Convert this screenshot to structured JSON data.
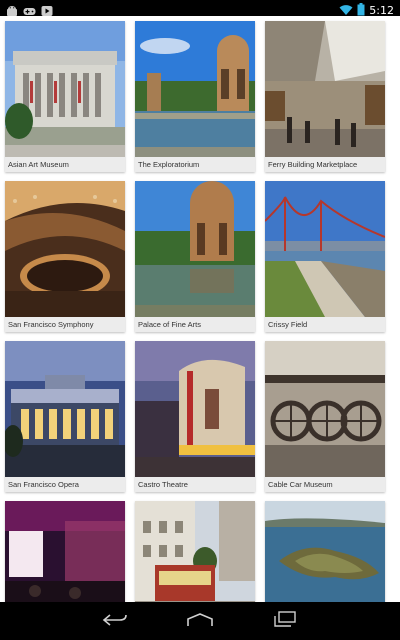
{
  "status_bar": {
    "time": "5:12",
    "left_icons": [
      "android-icon",
      "gamepad-icon",
      "play-icon"
    ],
    "right_icons": [
      "wifi-icon",
      "battery-icon"
    ]
  },
  "places": [
    {
      "label": "Asian Art Museum",
      "image": "asian-art-museum-photo"
    },
    {
      "label": "The Exploratorium",
      "image": "exploratorium-photo"
    },
    {
      "label": "Ferry Building Marketplace",
      "image": "ferry-building-photo"
    },
    {
      "label": "San Francisco Symphony",
      "image": "symphony-photo"
    },
    {
      "label": "Palace of Fine Arts",
      "image": "palace-of-fine-arts-photo"
    },
    {
      "label": "Crissy Field",
      "image": "crissy-field-photo"
    },
    {
      "label": "San Francisco Opera",
      "image": "opera-photo"
    },
    {
      "label": "Castro Theatre",
      "image": "castro-theatre-photo"
    },
    {
      "label": "Cable Car Museum",
      "image": "cable-car-museum-photo"
    },
    {
      "label": "",
      "image": "concert-stage-photo"
    },
    {
      "label": "",
      "image": "cable-car-street-photo"
    },
    {
      "label": "",
      "image": "island-aerial-photo"
    }
  ],
  "nav_bar": {
    "buttons": [
      "back-icon",
      "home-icon",
      "recent-apps-icon"
    ]
  }
}
